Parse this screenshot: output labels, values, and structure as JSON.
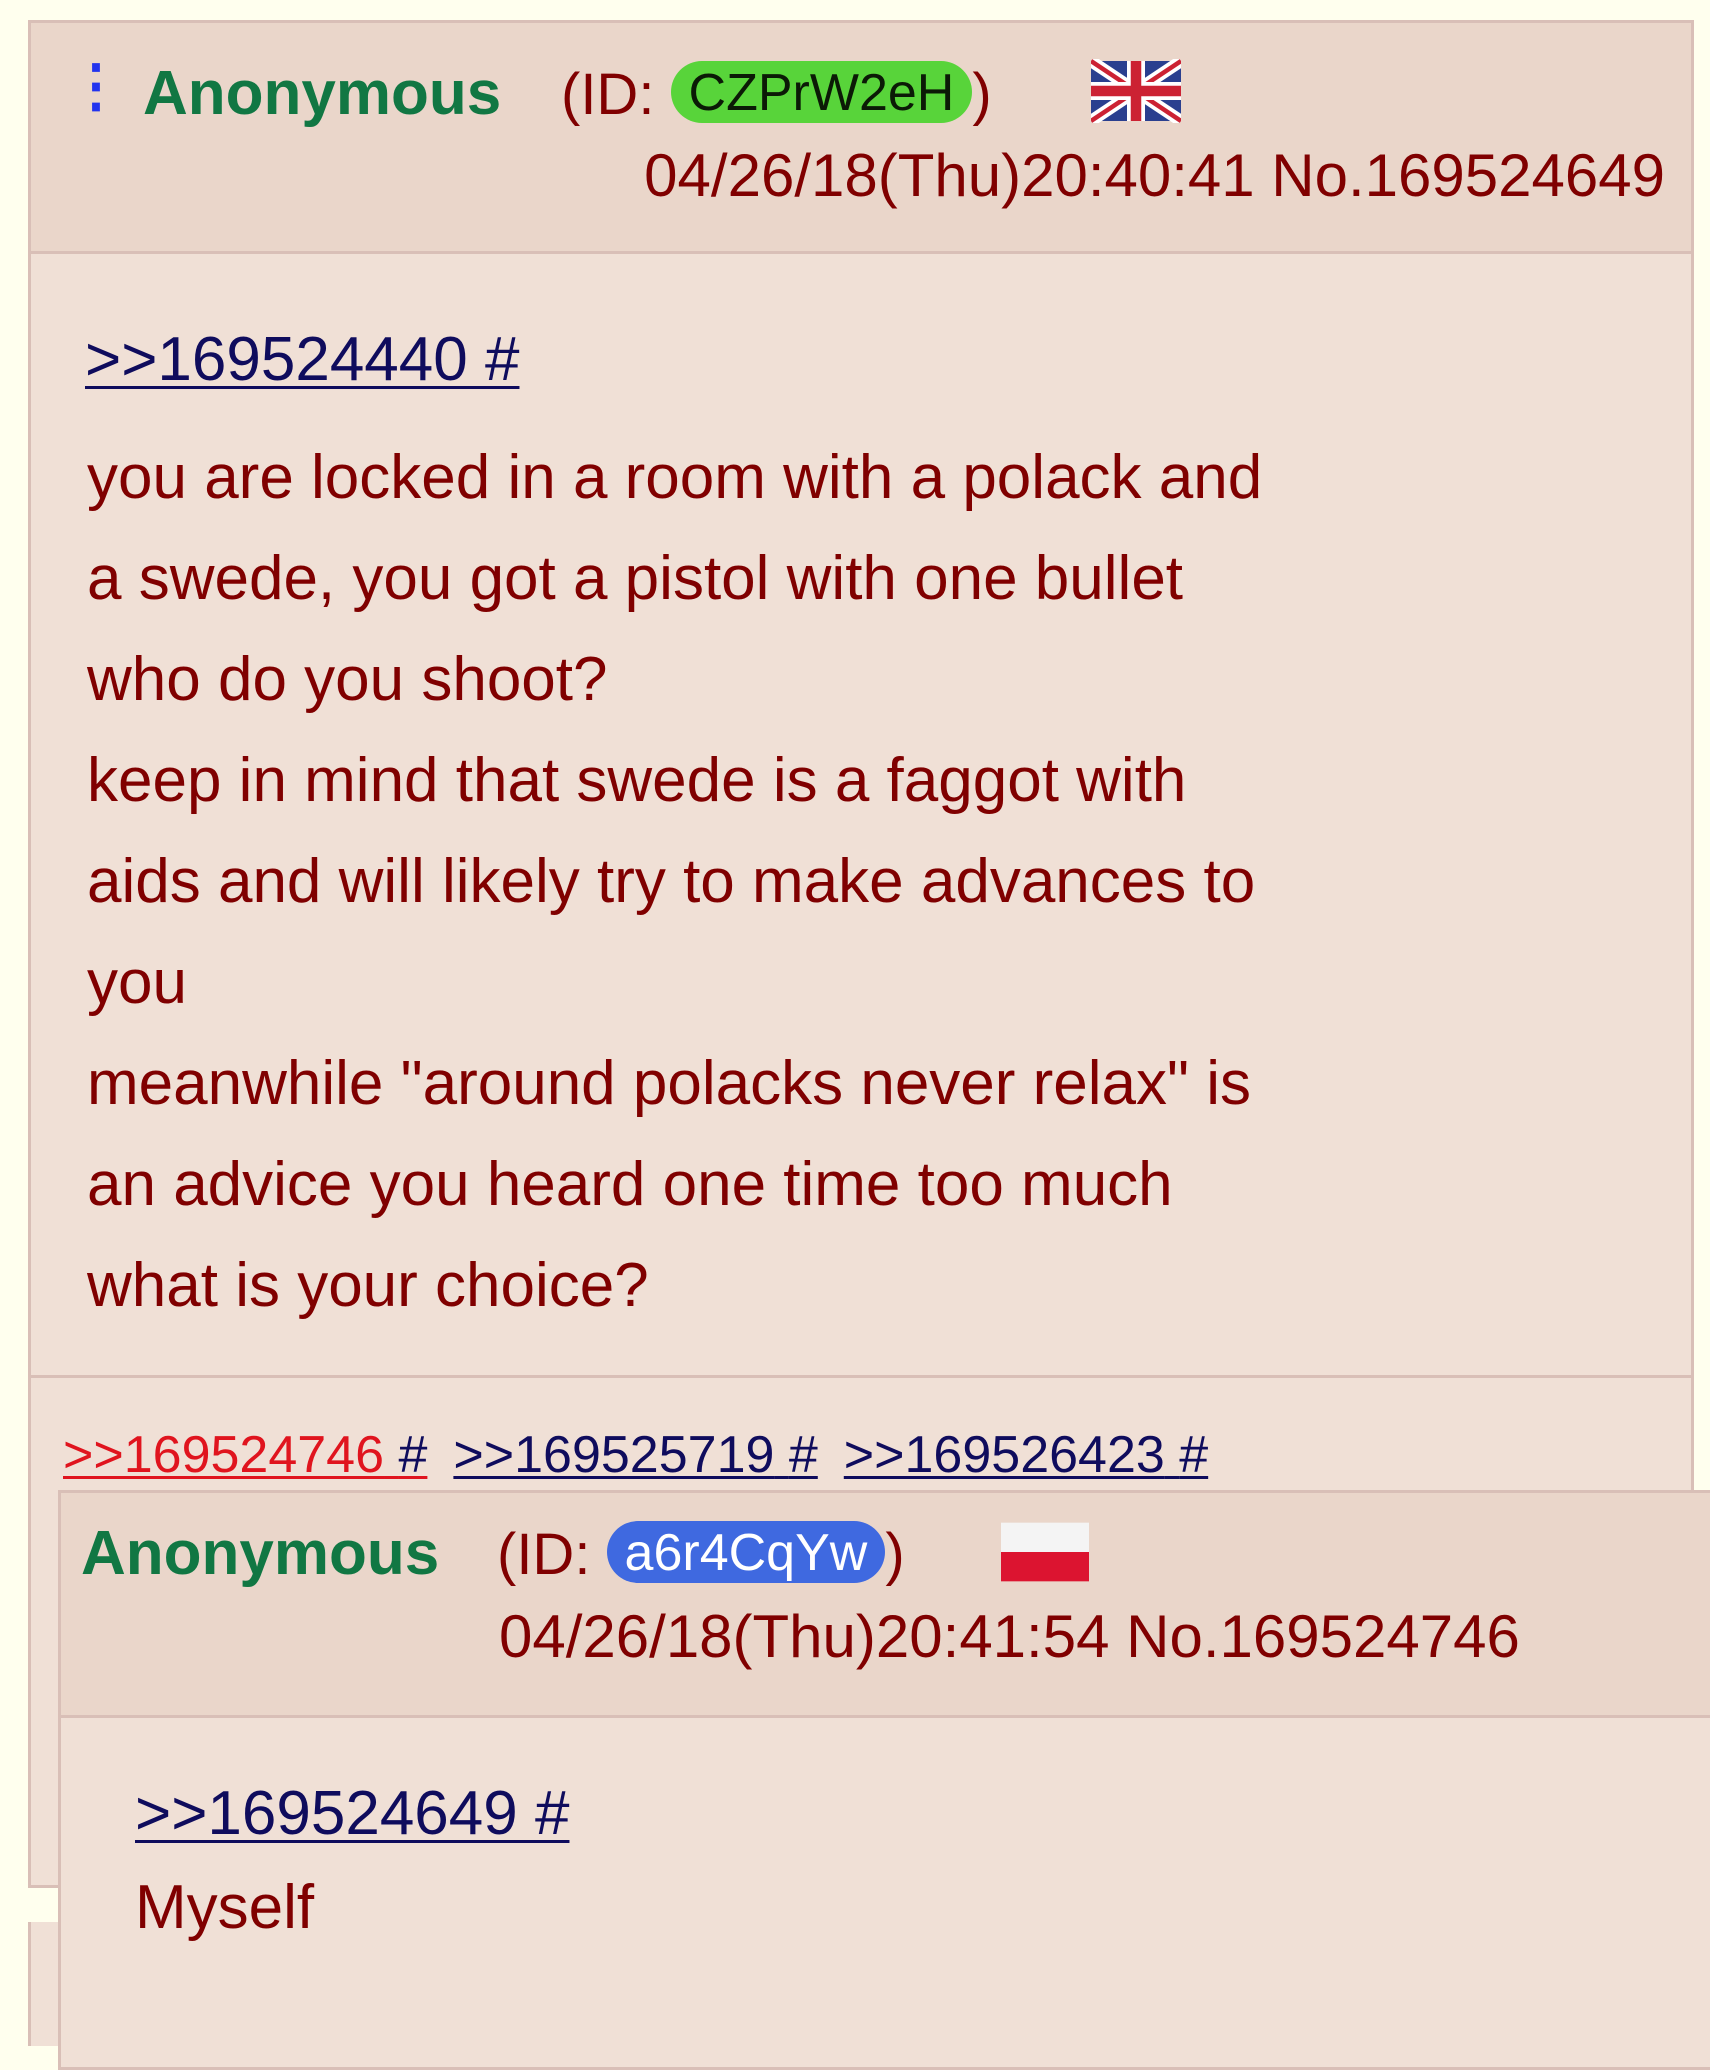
{
  "post1": {
    "name": "Anonymous",
    "id_prefix": "(ID: ",
    "id": "CZPrW2eH",
    "id_suffix": ")",
    "flag": "uk-flag",
    "datetime": "04/26/18(Thu)20:40:41 No.169524649",
    "quote_link": ">>169524440 #",
    "body": "you are locked in a room with a polack and\na swede, you got a pistol with one bullet\nwho do you shoot?\nkeep in mind that swede is a faggot with\naids and will likely try to make advances to\nyou\nmeanwhile \"around polacks never relax\" is\nan advice you heard one time too much\nwhat is your choice?",
    "backlinks": [
      {
        "num": ">>169524746",
        "hash": "#"
      },
      {
        "num": ">>169525719",
        "hash": "#"
      },
      {
        "num": ">>169526423",
        "hash": "#"
      }
    ]
  },
  "post2": {
    "name": "Anonymous",
    "id_prefix": "(ID: ",
    "id": "a6r4CqYw",
    "id_suffix": ")",
    "flag": "poland-flag",
    "datetime": "04/26/18(Thu)20:41:54 No.169524746",
    "quote_link": ">>169524649 #",
    "body": "Myself"
  },
  "colors": {
    "post_bg": "#f0e0d6",
    "header_bg": "#ead6ca",
    "border": "#d9bfb7",
    "name_green": "#117743",
    "text_maroon": "#800000",
    "link_blue": "#0f0c5d",
    "highlight_red": "#e0141e",
    "id_green": "#58d43a",
    "id_blue": "#3f69e0"
  }
}
